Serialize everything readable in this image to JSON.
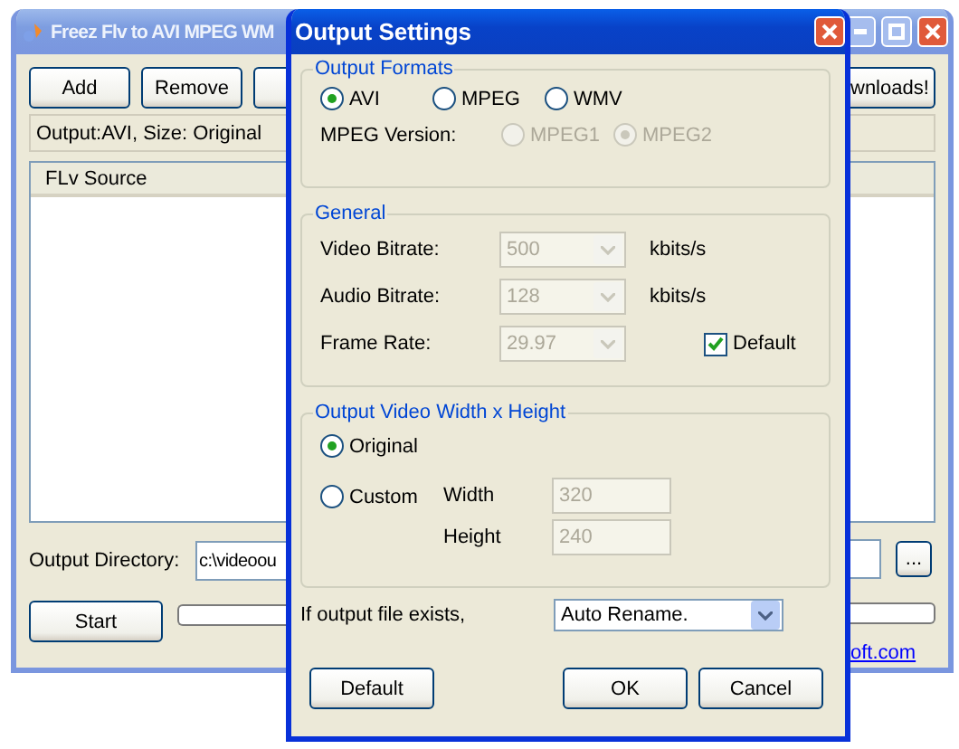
{
  "main_window": {
    "title": "Freez Flv to AVI MPEG WM",
    "toolbar_buttons": [
      "Add",
      "Remove"
    ],
    "right_button": "wnloads!",
    "status": "Output:AVI, Size: Original",
    "list_header": "FLv Source",
    "output_directory": {
      "label": "Output Directory:",
      "value": "c:\\videoou"
    },
    "browse_button": "...",
    "start_button": "Start",
    "progress": {
      "level": 0
    },
    "link": "oft.com"
  },
  "dialog": {
    "title": "Output Settings",
    "formats": {
      "legend": "Output Formats",
      "options": [
        {
          "label": "AVI",
          "selected": true
        },
        {
          "label": "MPEG",
          "selected": false
        },
        {
          "label": "WMV",
          "selected": false
        }
      ],
      "mpeg_version": {
        "label": "MPEG Version:",
        "options": [
          {
            "label": "MPEG1",
            "selected": false,
            "disabled": true
          },
          {
            "label": "MPEG2",
            "selected": true,
            "disabled": true
          }
        ]
      }
    },
    "general": {
      "legend": "General",
      "rows": [
        {
          "label": "Video Bitrate:",
          "value": "500",
          "unit": "kbits/s",
          "disabled": true
        },
        {
          "label": "Audio Bitrate:",
          "value": "128",
          "unit": "kbits/s",
          "disabled": true
        },
        {
          "label": "Frame Rate:",
          "value": "29.97",
          "disabled": true
        }
      ],
      "default_checkbox": {
        "label": "Default",
        "checked": true
      }
    },
    "size": {
      "legend": "Output Video Width x Height",
      "options": [
        {
          "label": "Original",
          "selected": true
        },
        {
          "label": "Custom",
          "selected": false
        }
      ],
      "fields": [
        {
          "label": "Width",
          "value": "320",
          "disabled": true
        },
        {
          "label": "Height",
          "value": "240",
          "disabled": true
        }
      ]
    },
    "exists": {
      "label": "If output file exists,",
      "value": "Auto Rename."
    },
    "buttons": [
      "Default",
      "OK",
      "Cancel"
    ]
  }
}
